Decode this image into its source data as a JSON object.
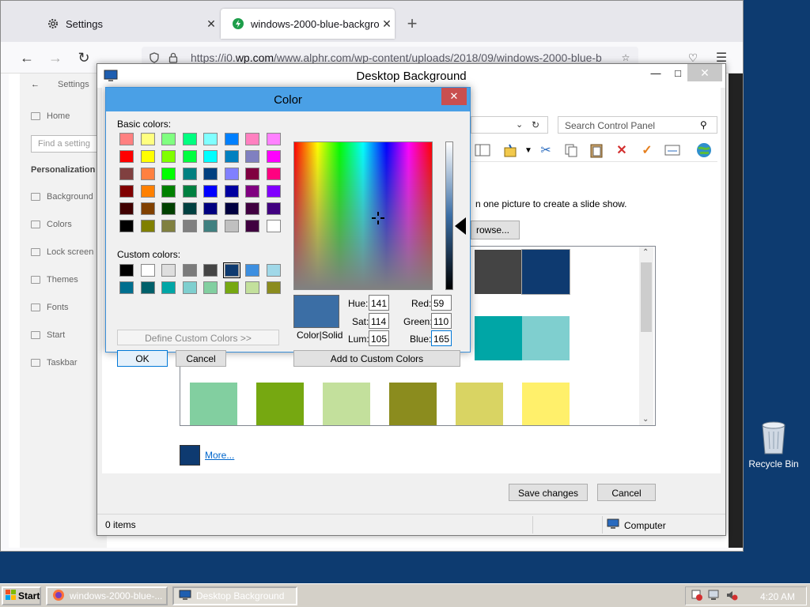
{
  "browser": {
    "tabs": [
      {
        "label": "Settings",
        "icon": "gear-icon"
      },
      {
        "label": "windows-2000-blue-backgroun",
        "icon": "globe-icon"
      }
    ],
    "new_tab_label": "+",
    "url_prefix": "https://i0.",
    "url_domain": "wp.com",
    "url_rest": "/www.alphr.com/wp-content/uploads/2018/09/windows-2000-blue-b"
  },
  "settings_bg": {
    "header": "Settings",
    "home": "Home",
    "find_placeholder": "Find a setting",
    "section": "Personalization",
    "items": [
      "Background",
      "Colors",
      "Lock screen",
      "Themes",
      "Fonts",
      "Start",
      "Taskbar"
    ]
  },
  "desktop_bg_window": {
    "title": "Desktop Background",
    "search_placeholder": "Search Control Panel",
    "hint": "n one picture to create a slide show.",
    "browse_label": "rowse...",
    "more_label": "More...",
    "save_label": "Save changes",
    "cancel_label": "Cancel",
    "status_items": "0 items",
    "status_location": "Computer",
    "swatches_row1": [
      "#444444",
      "#0e3a70"
    ],
    "swatches_row2": [
      "#00a6a6",
      "#7fcfcf"
    ],
    "swatches_row3": [
      "#82cfa0",
      "#76a811",
      "#c3e09c",
      "#8b8c1e",
      "#d9d463",
      "#fff06b"
    ]
  },
  "color_dialog": {
    "title": "Color",
    "basic_label": "Basic colors:",
    "custom_label": "Custom colors:",
    "basic_colors": [
      [
        "#ff8080",
        "#ffff80",
        "#80ff80",
        "#00ff80",
        "#80ffff",
        "#0080ff",
        "#ff80c0",
        "#ff80ff"
      ],
      [
        "#ff0000",
        "#ffff00",
        "#80ff00",
        "#00ff40",
        "#00ffff",
        "#0080c0",
        "#8080c0",
        "#ff00ff"
      ],
      [
        "#804040",
        "#ff8040",
        "#00ff00",
        "#008080",
        "#004080",
        "#8080ff",
        "#800040",
        "#ff0080"
      ],
      [
        "#800000",
        "#ff8000",
        "#008000",
        "#008040",
        "#0000ff",
        "#0000a0",
        "#800080",
        "#8000ff"
      ],
      [
        "#400000",
        "#804000",
        "#004000",
        "#004040",
        "#000080",
        "#000040",
        "#400040",
        "#400080"
      ],
      [
        "#000000",
        "#808000",
        "#808040",
        "#808080",
        "#408080",
        "#c0c0c0",
        "#400040",
        "#ffffff"
      ]
    ],
    "custom_colors": [
      [
        "#000000",
        "#ffffff",
        "#dedede",
        "#7b7b7b",
        "#444444",
        "#0e3a70",
        "#3d8fe0",
        "#a0d8e8"
      ],
      [
        "#006f8f",
        "#00606a",
        "#00a6a6",
        "#7fcfcf",
        "#82cfa0",
        "#76a811",
        "#c3e09c",
        "#8b8c1e"
      ]
    ],
    "selected_custom_index": 5,
    "define_label": "Define Custom Colors >>",
    "ok_label": "OK",
    "cancel_label": "Cancel",
    "preview_label": "Color|Solid",
    "preview_color": "#3b6ea5",
    "hue_label": "Hue:",
    "hue": "141",
    "sat_label": "Sat:",
    "sat": "114",
    "lum_label": "Lum:",
    "lum": "105",
    "red_label": "Red:",
    "red": "59",
    "green_label": "Green:",
    "green": "110",
    "blue_label": "Blue:",
    "blue": "165",
    "add_custom_label": "Add to Custom Colors"
  },
  "desktop": {
    "recycle_label": "Recycle Bin"
  },
  "taskbar": {
    "start_label": "Start",
    "tasks": [
      "windows-2000-blue-...",
      "Desktop Background"
    ],
    "clock": "4:20 AM"
  }
}
